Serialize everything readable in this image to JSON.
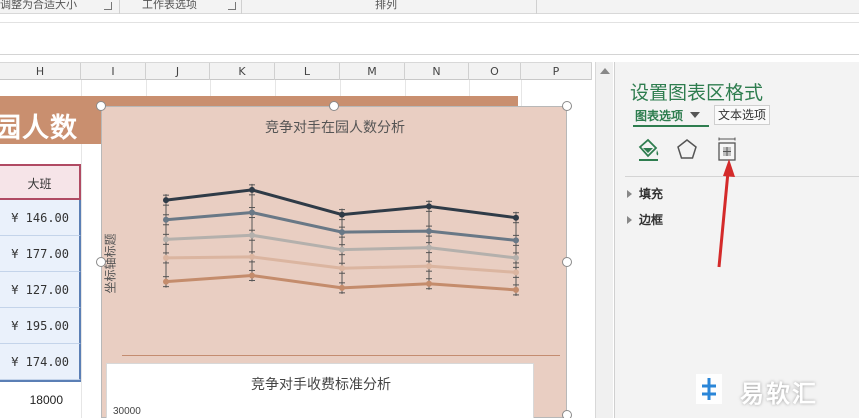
{
  "ribbon": {
    "group1_label": "调整为合适大小",
    "group2_label": "工作表选项",
    "group3_label": "排列"
  },
  "sheet": {
    "columns": [
      "H",
      "I",
      "J",
      "K",
      "L",
      "M",
      "N",
      "O",
      "P"
    ],
    "banner_text": "园人数",
    "header_cell": "大班",
    "values": [
      "¥ 146.00",
      "¥ 177.00",
      "¥ 127.00",
      "¥ 195.00",
      "¥ 174.00"
    ],
    "total_cell": "18000"
  },
  "chart": {
    "title": "竞争对手在园人数分析",
    "y_axis_title": "坐标轴标题",
    "second_chart_title": "竞争对手收费标准分析",
    "second_chart_tick": "30000"
  },
  "chart_data": {
    "type": "line",
    "title": "竞争对手在园人数分析",
    "ylabel": "坐标轴标题",
    "xlabel": "",
    "has_error_bars": true,
    "grid": false,
    "legend": "none",
    "series": [
      {
        "color": "#2f3b47",
        "values": [
          200,
          190,
          214,
          206,
          217
        ]
      },
      {
        "color": "#697886",
        "values": [
          219,
          212,
          231,
          230,
          239
        ]
      },
      {
        "color": "#b4b0ac",
        "values": [
          238,
          234,
          248,
          246,
          256
        ]
      },
      {
        "color": "#dbb5a0",
        "values": [
          256,
          255,
          266,
          264,
          270
        ]
      },
      {
        "color": "#c48c6c",
        "values": [
          279,
          273,
          285,
          281,
          287
        ]
      }
    ]
  },
  "format_pane": {
    "title": "设置图表区格式",
    "tab_chart_options": "图表选项",
    "tab_text_options": "文本选项",
    "icons": [
      "fill-line-icon",
      "effects-icon",
      "size-properties-icon"
    ],
    "sections": [
      "填充",
      "边框"
    ]
  },
  "watermark": {
    "text": "易软汇"
  },
  "colors": {
    "accent_green": "#2e7d4f",
    "banner": "#c98f6f",
    "chart_bg": "#e9cec2",
    "annotation_arrow": "#d42a2a"
  }
}
